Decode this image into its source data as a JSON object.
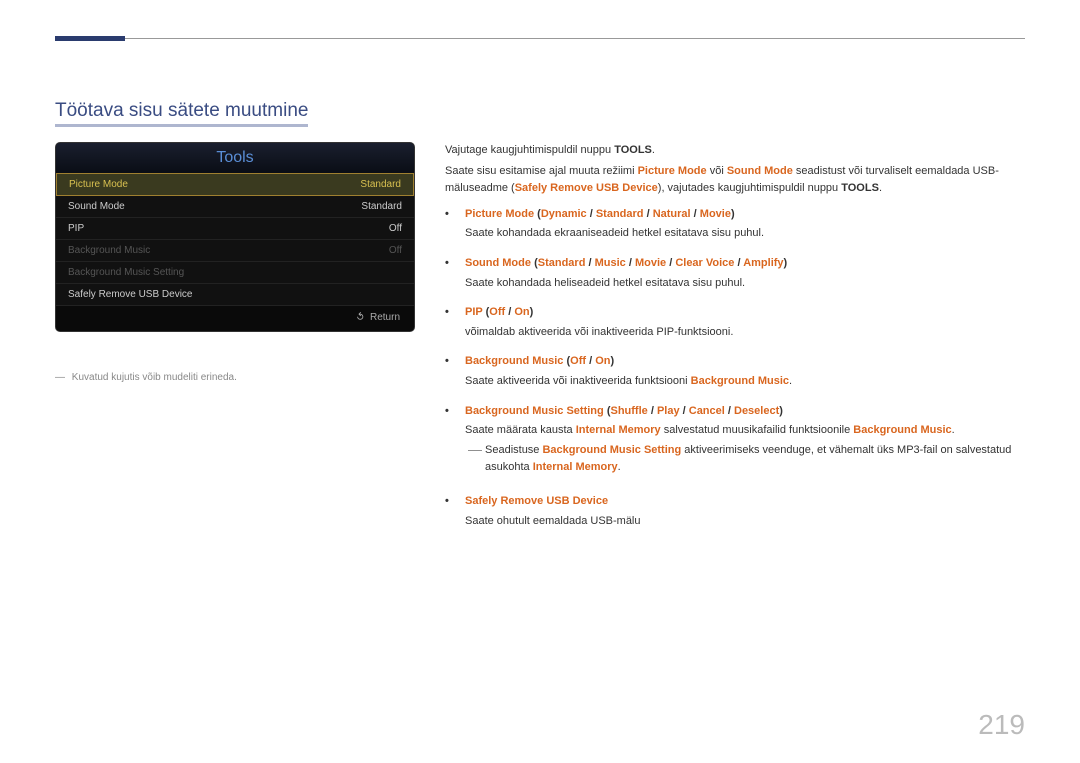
{
  "heading": "Töötava sisu sätete muutmine",
  "tv": {
    "title": "Tools",
    "rows": [
      {
        "label": "Picture Mode",
        "value": "Standard",
        "sel": true
      },
      {
        "label": "Sound Mode",
        "value": "Standard"
      },
      {
        "label": "PIP",
        "value": "Off"
      },
      {
        "label": "Background Music",
        "value": "Off",
        "dim": true
      },
      {
        "label": "Background Music Setting",
        "value": "",
        "dim": true
      },
      {
        "label": "Safely Remove USB Device",
        "value": ""
      }
    ],
    "return": "Return"
  },
  "caption": "Kuvatud kujutis võib mudeliti erineda.",
  "intro1_a": "Vajutage kaugjuhtimispuldil nuppu ",
  "intro1_b": "TOOLS",
  "intro1_c": ".",
  "intro2_a": "Saate sisu esitamise ajal muuta režiimi ",
  "intro2_pm": "Picture Mode",
  "intro2_b": " või ",
  "intro2_sm": "Sound Mode",
  "intro2_c": " seadistust või turvaliselt eemaldada USB-mäluseadme (",
  "intro2_safe": "Safely Remove USB Device",
  "intro2_d": "), vajutades kaugjuhtimispuldil nuppu ",
  "intro2_tools": "TOOLS",
  "intro2_e": ".",
  "items": {
    "pm": {
      "name": "Picture Mode",
      "opts": [
        "Dynamic",
        "Standard",
        "Natural",
        "Movie"
      ],
      "desc": "Saate kohandada ekraaniseadeid hetkel esitatava sisu puhul."
    },
    "sm": {
      "name": "Sound Mode",
      "opts": [
        "Standard",
        "Music",
        "Movie",
        "Clear Voice",
        "Amplify"
      ],
      "desc": "Saate kohandada heliseadeid hetkel esitatava sisu puhul."
    },
    "pip": {
      "name": "PIP",
      "opts": [
        "Off",
        "On"
      ],
      "desc": "võimaldab aktiveerida või inaktiveerida PIP-funktsiooni."
    },
    "bgm": {
      "name": "Background Music",
      "opts": [
        "Off",
        "On"
      ],
      "desc_a": "Saate aktiveerida või inaktiveerida funktsiooni ",
      "desc_b": "Background Music",
      "desc_c": "."
    },
    "bgms": {
      "name": "Background Music Setting",
      "opts": [
        "Shuffle",
        "Play",
        "Cancel",
        "Deselect"
      ],
      "desc_a": "Saate määrata kausta ",
      "desc_im": "Internal Memory",
      "desc_b": " salvestatud muusikafailid funktsioonile ",
      "desc_bg": "Background Music",
      "desc_c": ".",
      "note_a": "Seadistuse ",
      "note_bgms": "Background Music Setting",
      "note_b": " aktiveerimiseks veenduge, et vähemalt üks MP3-fail on salvestatud asukohta ",
      "note_im": "Internal Memory",
      "note_c": "."
    },
    "safe": {
      "name": "Safely Remove USB Device",
      "desc": "Saate ohutult eemaldada USB-mälu"
    }
  },
  "pagenum": "219"
}
